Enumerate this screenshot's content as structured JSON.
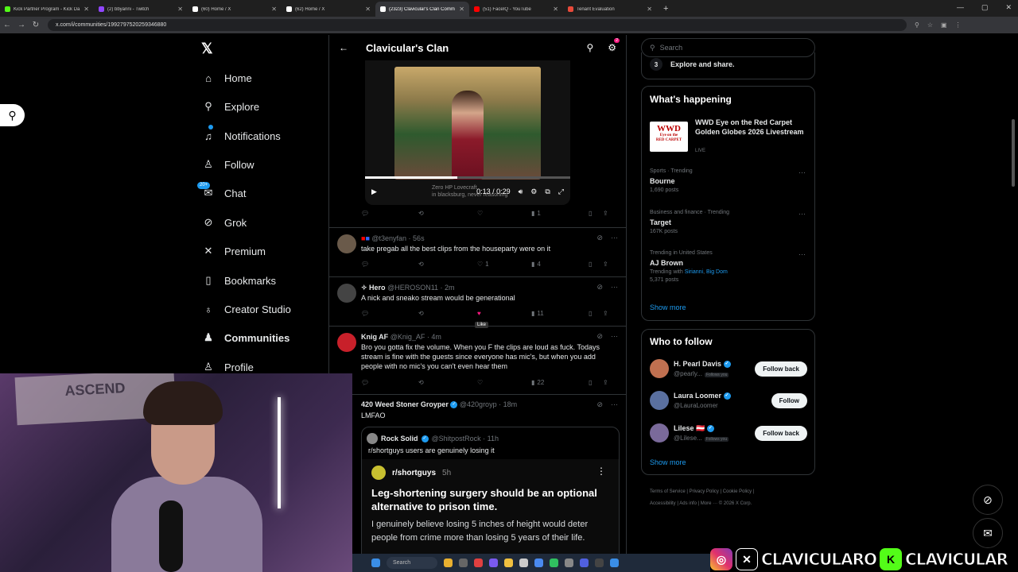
{
  "browser": {
    "tabs": [
      {
        "title": "Kick Partner Program - Kick Da",
        "color": "#53fc18"
      },
      {
        "title": "(2) bbyanni - Twitch",
        "color": "#9146ff"
      },
      {
        "title": "(60) Home / X",
        "color": "#ffffff"
      },
      {
        "title": "(62) Home / X",
        "color": "#ffffff"
      },
      {
        "title": "(2323) Clavicular's Clan Comm",
        "color": "#ffffff"
      },
      {
        "title": "(51) FaceIQ - YouTube",
        "color": "#ff0000"
      },
      {
        "title": "Tenant Evaluation",
        "color": "#e84a3a"
      }
    ],
    "url": "x.com/i/communities/1992797520259346880"
  },
  "nav": {
    "items": [
      {
        "label": "Home",
        "icon": "home-icon",
        "glyph": "⌂"
      },
      {
        "label": "Explore",
        "icon": "search-icon",
        "glyph": "⚲"
      },
      {
        "label": "Notifications",
        "icon": "bell-icon",
        "glyph": "♫"
      },
      {
        "label": "Follow",
        "icon": "person-plus-icon",
        "glyph": "♙"
      },
      {
        "label": "Chat",
        "icon": "mail-icon",
        "glyph": "✉"
      },
      {
        "label": "Grok",
        "icon": "grok-icon",
        "glyph": "⊘"
      },
      {
        "label": "Premium",
        "icon": "x-icon",
        "glyph": "✕"
      },
      {
        "label": "Bookmarks",
        "icon": "bookmark-icon",
        "glyph": "▯"
      },
      {
        "label": "Creator Studio",
        "icon": "flask-icon",
        "glyph": "♁"
      },
      {
        "label": "Communities",
        "icon": "people-icon",
        "glyph": "♟"
      },
      {
        "label": "Profile",
        "icon": "profile-icon",
        "glyph": "♙"
      }
    ],
    "chat_badge": "20+"
  },
  "feed": {
    "title": "Clavicular's Clan",
    "gear_badge": "2",
    "video": {
      "time": "0:13 / 0:29",
      "caption1": "Zero HP Lovecraft",
      "caption2": "in blacksburg, never reasoning",
      "progress": 0.45
    },
    "video_actions": {
      "views": "1"
    },
    "tweets": [
      {
        "name": "",
        "handle": "@t3enyfan · 56s",
        "text": "take pregab all the best clips from the houseparty were on it",
        "likes": "1",
        "views": "4"
      },
      {
        "name": "✧ Hero",
        "handle": "@HEROSON11 · 2m",
        "text": "A nick and sneako stream would be generational",
        "likes": "",
        "views": "11"
      },
      {
        "name": "Knig AF",
        "handle": "@Knig_AF · 4m",
        "text": "Bro you gotta fix the volume. When you F the clips are loud as fuck. Todays stream is fine with the guests since everyone has mic's, but when you add people with no mic's you can't even hear them",
        "likes": "",
        "views": "22"
      },
      {
        "name": "420 Weed Stoner Groyper",
        "handle": "@420groyp · 18m",
        "text": "LMFAO",
        "likes": "",
        "views": ""
      }
    ],
    "like_tooltip": "Like",
    "quote": {
      "name": "Rock Solid",
      "handle": "@ShitpostRock · 11h",
      "text": "r/shortguys users are genuinely losing it",
      "reddit": {
        "sub": "r/shortguys",
        "age": "5h",
        "title": "Leg-shortening surgery should be an optional alternative to prison time.",
        "body": "I genuinely believe losing 5 inches of height would deter people from crime more than losing 5 years of their life."
      }
    }
  },
  "sidebar": {
    "search_placeholder": "Search",
    "step": {
      "num": "3",
      "text": "Explore and share."
    },
    "happening_title": "What's happening",
    "wwd": {
      "logo": "WWD Eye on the RED CARPET",
      "title": "WWD Eye on the Red Carpet Golden Globes 2026 Livestream",
      "live": "LIVE"
    },
    "trends": [
      {
        "meta": "Sports · Trending",
        "name": "Bourne",
        "count": "1,690 posts",
        "with": ""
      },
      {
        "meta": "Business and finance · Trending",
        "name": "Target",
        "count": "167K posts",
        "with": ""
      },
      {
        "meta": "Trending in United States",
        "name": "AJ Brown",
        "count": "5,371 posts",
        "with_prefix": "Trending with",
        "with1": "Sirianni",
        "with2": "Big Dom"
      }
    ],
    "show_more": "Show more",
    "wtf_title": "Who to follow",
    "follow": [
      {
        "name": "H. Pearl Davis",
        "handle": "@pearly...",
        "follows_you": "Follows you",
        "btn": "Follow back",
        "color": "#c07050"
      },
      {
        "name": "Laura Loomer",
        "handle": "@LauraLoomer",
        "follows_you": "",
        "btn": "Follow",
        "color": "#5a70a0"
      },
      {
        "name": "Lilese 🇦🇹",
        "handle": "@Lilese...",
        "follows_you": "Follows you",
        "btn": "Follow back",
        "color": "#7a6a9a"
      }
    ],
    "footer": {
      "l1": "Terms of Service  |  Privacy Policy  |  Cookie Policy  |",
      "l2": "Accessibility  |  Ads info  |  More ···  © 2026 X Corp."
    }
  },
  "taskbar": {
    "search": "Search"
  },
  "overlay": {
    "text": "CLAVICULARO",
    "text2": "CLAVICULAR"
  }
}
